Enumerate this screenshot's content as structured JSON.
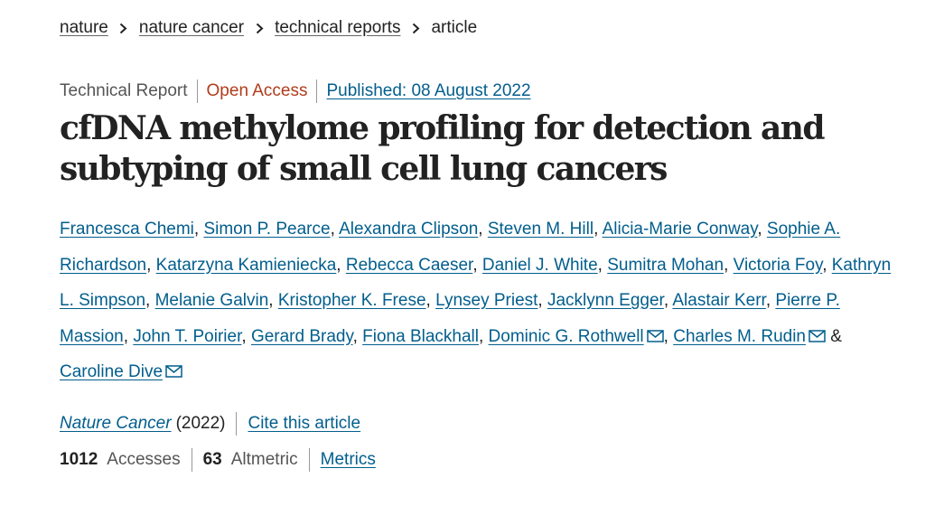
{
  "breadcrumb": {
    "items": [
      "nature",
      "nature cancer",
      "technical reports"
    ],
    "current": "article"
  },
  "meta": {
    "article_type": "Technical Report",
    "access": "Open Access",
    "published": "Published: 08 August 2022"
  },
  "title": "cfDNA methylome profiling for detection and subtyping of small cell lung cancers",
  "authors": [
    {
      "name": "Francesca Chemi",
      "email": false
    },
    {
      "name": "Simon P. Pearce",
      "email": false
    },
    {
      "name": "Alexandra Clipson",
      "email": false
    },
    {
      "name": "Steven M. Hill",
      "email": false
    },
    {
      "name": "Alicia-Marie Conway",
      "email": false
    },
    {
      "name": "Sophie A. Richardson",
      "email": false
    },
    {
      "name": "Katarzyna Kamieniecka",
      "email": false
    },
    {
      "name": "Rebecca Caeser",
      "email": false
    },
    {
      "name": "Daniel J. White",
      "email": false
    },
    {
      "name": "Sumitra Mohan",
      "email": false
    },
    {
      "name": "Victoria Foy",
      "email": false
    },
    {
      "name": "Kathryn L. Simpson",
      "email": false
    },
    {
      "name": "Melanie Galvin",
      "email": false
    },
    {
      "name": "Kristopher K. Frese",
      "email": false
    },
    {
      "name": "Lynsey Priest",
      "email": false
    },
    {
      "name": "Jacklynn Egger",
      "email": false
    },
    {
      "name": "Alastair Kerr",
      "email": false
    },
    {
      "name": "Pierre P. Massion",
      "email": false
    },
    {
      "name": "John T. Poirier",
      "email": false
    },
    {
      "name": "Gerard Brady",
      "email": false
    },
    {
      "name": "Fiona Blackhall",
      "email": false
    },
    {
      "name": "Dominic G. Rothwell",
      "email": true
    },
    {
      "name": "Charles M. Rudin",
      "email": true
    },
    {
      "name": "Caroline Dive",
      "email": true
    }
  ],
  "separators": {
    "comma": ", ",
    "and": " & "
  },
  "journal": {
    "name": "Nature Cancer",
    "year": "(2022)",
    "cite_label": "Cite this article"
  },
  "metrics": {
    "accesses_count": "1012",
    "accesses_label": "Accesses",
    "altmetric_count": "63",
    "altmetric_label": "Altmetric",
    "metrics_link": "Metrics"
  },
  "icons": {
    "breadcrumb_separator": "chevron-right-icon",
    "author_email": "mail-icon"
  },
  "colors": {
    "link": "#025e8d",
    "open_access": "#b13d1b",
    "text": "#222222",
    "muted": "#555555"
  }
}
